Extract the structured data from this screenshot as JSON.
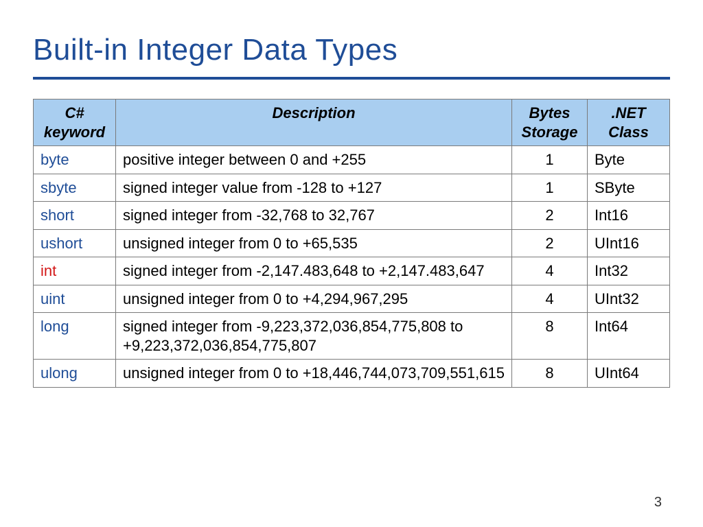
{
  "title": "Built-in Integer Data Types",
  "page_number": "3",
  "table": {
    "headers": {
      "keyword": "C# keyword",
      "description": "Description",
      "bytes": "Bytes Storage",
      "net": ".NET Class"
    },
    "rows": [
      {
        "keyword": "byte",
        "highlight": false,
        "description": "positive integer between 0 and +255",
        "bytes": "1",
        "net": "Byte"
      },
      {
        "keyword": "sbyte",
        "highlight": false,
        "description": "signed integer value from -128 to +127",
        "bytes": "1",
        "net": "SByte"
      },
      {
        "keyword": "short",
        "highlight": false,
        "description": "signed integer from -32,768 to 32,767",
        "bytes": "2",
        "net": "Int16"
      },
      {
        "keyword": "ushort",
        "highlight": false,
        "description": "unsigned integer from 0 to +65,535",
        "bytes": "2",
        "net": "UInt16"
      },
      {
        "keyword": "int",
        "highlight": true,
        "description": "signed integer from -2,147.483,648 to +2,147.483,647",
        "bytes": "4",
        "net": "Int32"
      },
      {
        "keyword": "uint",
        "highlight": false,
        "description": "unsigned integer from 0 to +4,294,967,295",
        "bytes": "4",
        "net": "UInt32"
      },
      {
        "keyword": "long",
        "highlight": false,
        "description": "signed integer from -9,223,372,036,854,775,808 to +9,223,372,036,854,775,807",
        "bytes": "8",
        "net": "Int64"
      },
      {
        "keyword": "ulong",
        "highlight": false,
        "description": "unsigned integer from 0 to +18,446,744,073,709,551,615",
        "bytes": "8",
        "net": "UInt64"
      }
    ]
  }
}
